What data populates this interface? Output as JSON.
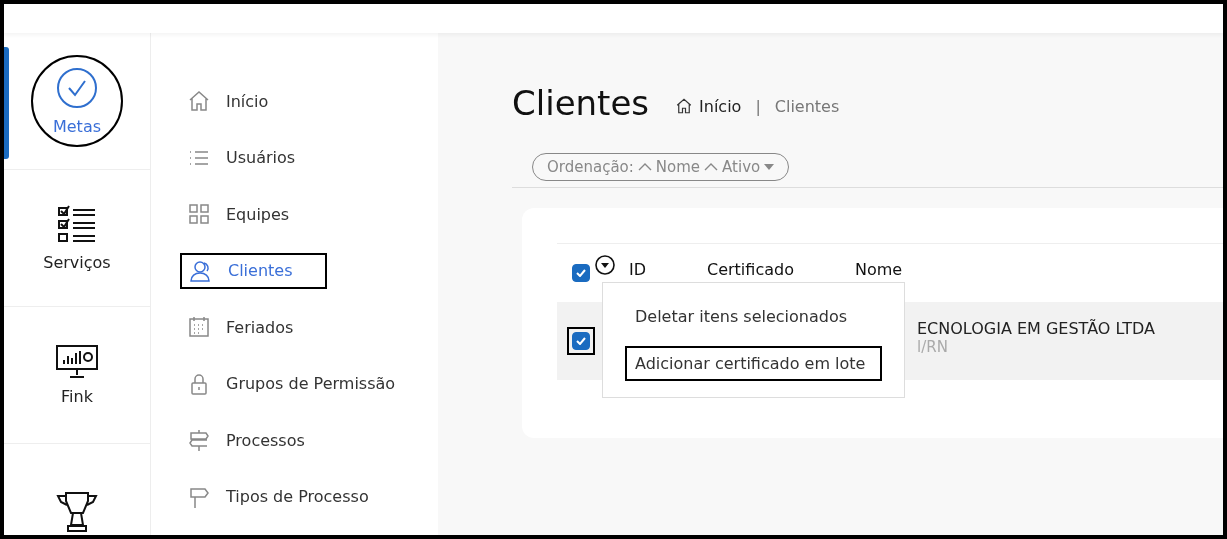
{
  "rail": [
    {
      "label": "Metas",
      "kind": "goal",
      "selected": true,
      "highlighted": true
    },
    {
      "label": "Serviços",
      "kind": "checklist",
      "selected": false,
      "highlighted": false
    },
    {
      "label": "Fink",
      "kind": "monitor",
      "selected": false,
      "highlighted": false
    },
    {
      "kind": "trophy",
      "selected": false,
      "highlighted": false
    }
  ],
  "nav": [
    {
      "label": "Início",
      "kind": "home",
      "selected": false,
      "highlighted": false
    },
    {
      "label": "Usuários",
      "kind": "list",
      "selected": false,
      "highlighted": false
    },
    {
      "label": "Equipes",
      "kind": "grid",
      "selected": false,
      "highlighted": false
    },
    {
      "label": "Clientes",
      "kind": "users",
      "selected": true,
      "highlighted": true
    },
    {
      "label": "Feriados",
      "kind": "calendar",
      "selected": false,
      "highlighted": false
    },
    {
      "label": "Grupos de Permissão",
      "kind": "lock",
      "selected": false,
      "highlighted": false
    },
    {
      "label": "Processos",
      "kind": "signpost",
      "selected": false,
      "highlighted": false
    },
    {
      "label": "Tipos de Processo",
      "kind": "sign",
      "selected": false,
      "highlighted": false
    }
  ],
  "page": {
    "title": "Clientes",
    "breadcrumb": [
      {
        "label": "Início",
        "kind": "home"
      },
      {
        "label": "Clientes",
        "kind": "current"
      }
    ],
    "breadcrumb_separator": "|"
  },
  "sort": {
    "label": "Ordenação:",
    "keys": [
      {
        "label": "Nome"
      },
      {
        "label": "Ativo"
      }
    ]
  },
  "table": {
    "select_all_checked": true,
    "columns": [
      "ID",
      "Certificado",
      "Nome"
    ],
    "rows": [
      {
        "checked": true,
        "highlighted": true,
        "name": "ECNOLOGIA EM GESTÃO LTDA",
        "detail": "l/RN"
      }
    ]
  },
  "menu": {
    "open": true,
    "items": [
      {
        "label": "Deletar itens selecionados",
        "highlighted": false
      },
      {
        "label": "Adicionar certificado em lote",
        "highlighted": true
      }
    ]
  }
}
